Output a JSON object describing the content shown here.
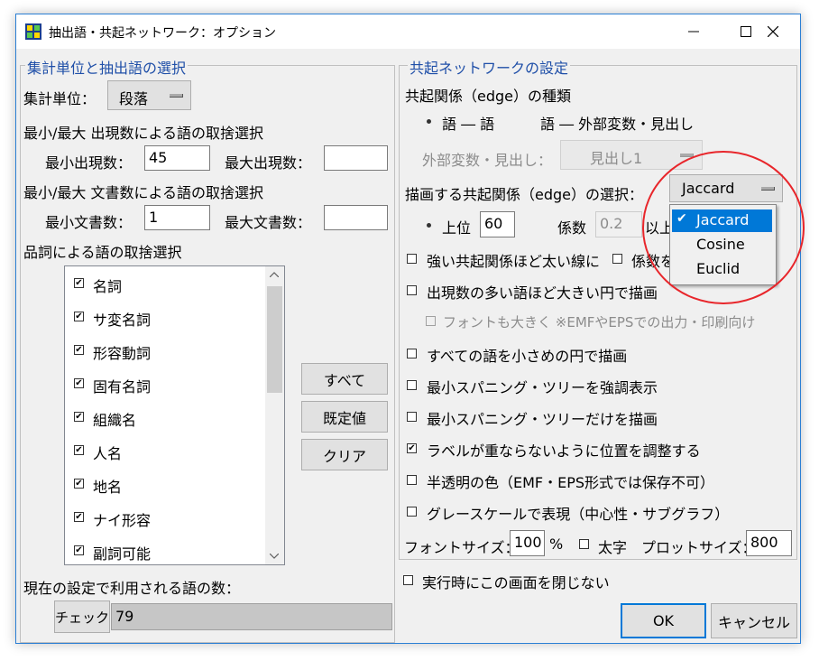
{
  "window": {
    "title": "抽出語・共起ネットワーク：オプション"
  },
  "left_group": {
    "legend": "集計単位と抽出語の選択",
    "unit_label": "集計単位：",
    "unit_value": "段落",
    "freq_heading": "最小/最大 出現数による語の取捨選択",
    "min_freq_label": "最小出現数：",
    "min_freq_value": "45",
    "max_freq_label": "最大出現数：",
    "max_freq_value": "",
    "doc_heading": "最小/最大 文書数による語の取捨選択",
    "min_doc_label": "最小文書数：",
    "min_doc_value": "1",
    "max_doc_label": "最大文書数：",
    "max_doc_value": "",
    "pos_heading": "品詞による語の取捨選択",
    "pos_items": [
      {
        "label": "名詞",
        "checked": true
      },
      {
        "label": "サ変名詞",
        "checked": true
      },
      {
        "label": "形容動詞",
        "checked": true
      },
      {
        "label": "固有名詞",
        "checked": true
      },
      {
        "label": "組織名",
        "checked": true
      },
      {
        "label": "人名",
        "checked": true
      },
      {
        "label": "地名",
        "checked": true
      },
      {
        "label": "ナイ形容",
        "checked": true
      },
      {
        "label": "副詞可能",
        "checked": true
      }
    ],
    "all_button": "すべて",
    "default_button": "既定値",
    "clear_button": "クリア",
    "count_label": "現在の設定で利用される語の数：",
    "check_button": "チェック",
    "count_value": "79"
  },
  "right_group": {
    "legend": "共起ネットワークの設定",
    "edge_type_label": "共起関係（edge）の種類",
    "radio_word_word": "語 ― 語",
    "radio_word_external": "語 ― 外部変数・見出し",
    "external_label": "外部変数・見出し：",
    "external_value": "見出し1",
    "select_label": "描画する共起関係（edge）の選択：",
    "measure_value": "Jaccard",
    "top_label": "上位",
    "top_value": "60",
    "coef_label": "係数",
    "coef_value": "0.2",
    "coef_suffix": "以上",
    "strong_thick": "強い共起関係ほど太い線に",
    "coef_partial": "係数を",
    "freq_larger": "出現数の多い語ほど大きい円で描画",
    "font_larger": "フォントも大きく ※EMFやEPSでの出力・印刷向け",
    "all_small": "すべての語を小さめの円で描画",
    "mst_emph": "最小スパニング・ツリーを強調表示",
    "mst_only": "最小スパニング・ツリーだけを描画",
    "no_overlap": "ラベルが重ならないように位置を調整する",
    "translucent": "半透明の色（EMF・EPS形式では保存不可）",
    "grayscale": "グレースケールで表現（中心性・サブグラフ）",
    "font_size_label": "フォントサイズ：",
    "font_size_value": "100",
    "font_size_unit": "%",
    "bold_label": "太字",
    "plot_size_label": "プロットサイズ：",
    "plot_size_value": "800"
  },
  "keep_open": "実行時にこの画面を閉じない",
  "ok_button": "OK",
  "cancel_button": "キャンセル",
  "dropdown": {
    "options": [
      "Jaccard",
      "Cosine",
      "Euclid"
    ],
    "selected": "Jaccard",
    "highlight_color": "#0078d7"
  },
  "annotation_color": "#e8262b"
}
